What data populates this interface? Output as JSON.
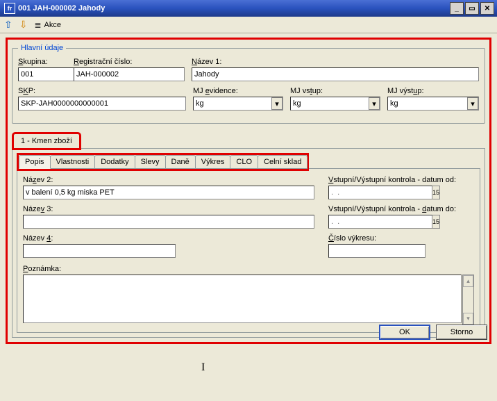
{
  "window": {
    "title": "001 JAH-000002 Jahody",
    "app_icon": "fr"
  },
  "toolbar": {
    "akce_label": "Akce"
  },
  "group_title": "Hlavní údaje",
  "fields": {
    "skupina_label": "Skupina:",
    "skupina_value": "001",
    "regcislo_label": "Registrační číslo:",
    "regcislo_value": "JAH-000002",
    "nazev1_label": "Název 1:",
    "nazev1_value": "Jahody",
    "skp_label": "SKP:",
    "skp_value": "SKP-JAH0000000000001",
    "mj_ev_label": "MJ evidence:",
    "mj_ev_value": "kg",
    "mj_in_label": "MJ vstup:",
    "mj_in_value": "kg",
    "mj_out_label": "MJ výstup:",
    "mj_out_value": "kg"
  },
  "section_tab": "1 - Kmen zboží",
  "subtabs": [
    "Popis",
    "Vlastnosti",
    "Dodatky",
    "Slevy",
    "Daně",
    "Výkres",
    "CLO",
    "Celní sklad"
  ],
  "popis": {
    "nazev2_label": "Název 2:",
    "nazev2_value": "v balení 0,5 kg miska PET",
    "nazev3_label": "Název 3:",
    "nazev3_value": "",
    "nazev4_label": "Název 4:",
    "nazev4_value": "",
    "poznamka_label": "Poznámka:",
    "kontrola_od_label": "Vstupní/Výstupní kontrola - datum od:",
    "kontrola_od_value": ".  .",
    "kontrola_do_label": "Vstupní/Výstupní kontrola - datum do:",
    "kontrola_do_value": ".  .",
    "cislo_vykresu_label": "Číslo výkresu:",
    "cislo_vykresu_value": ""
  },
  "buttons": {
    "ok": "OK",
    "storno": "Storno"
  }
}
